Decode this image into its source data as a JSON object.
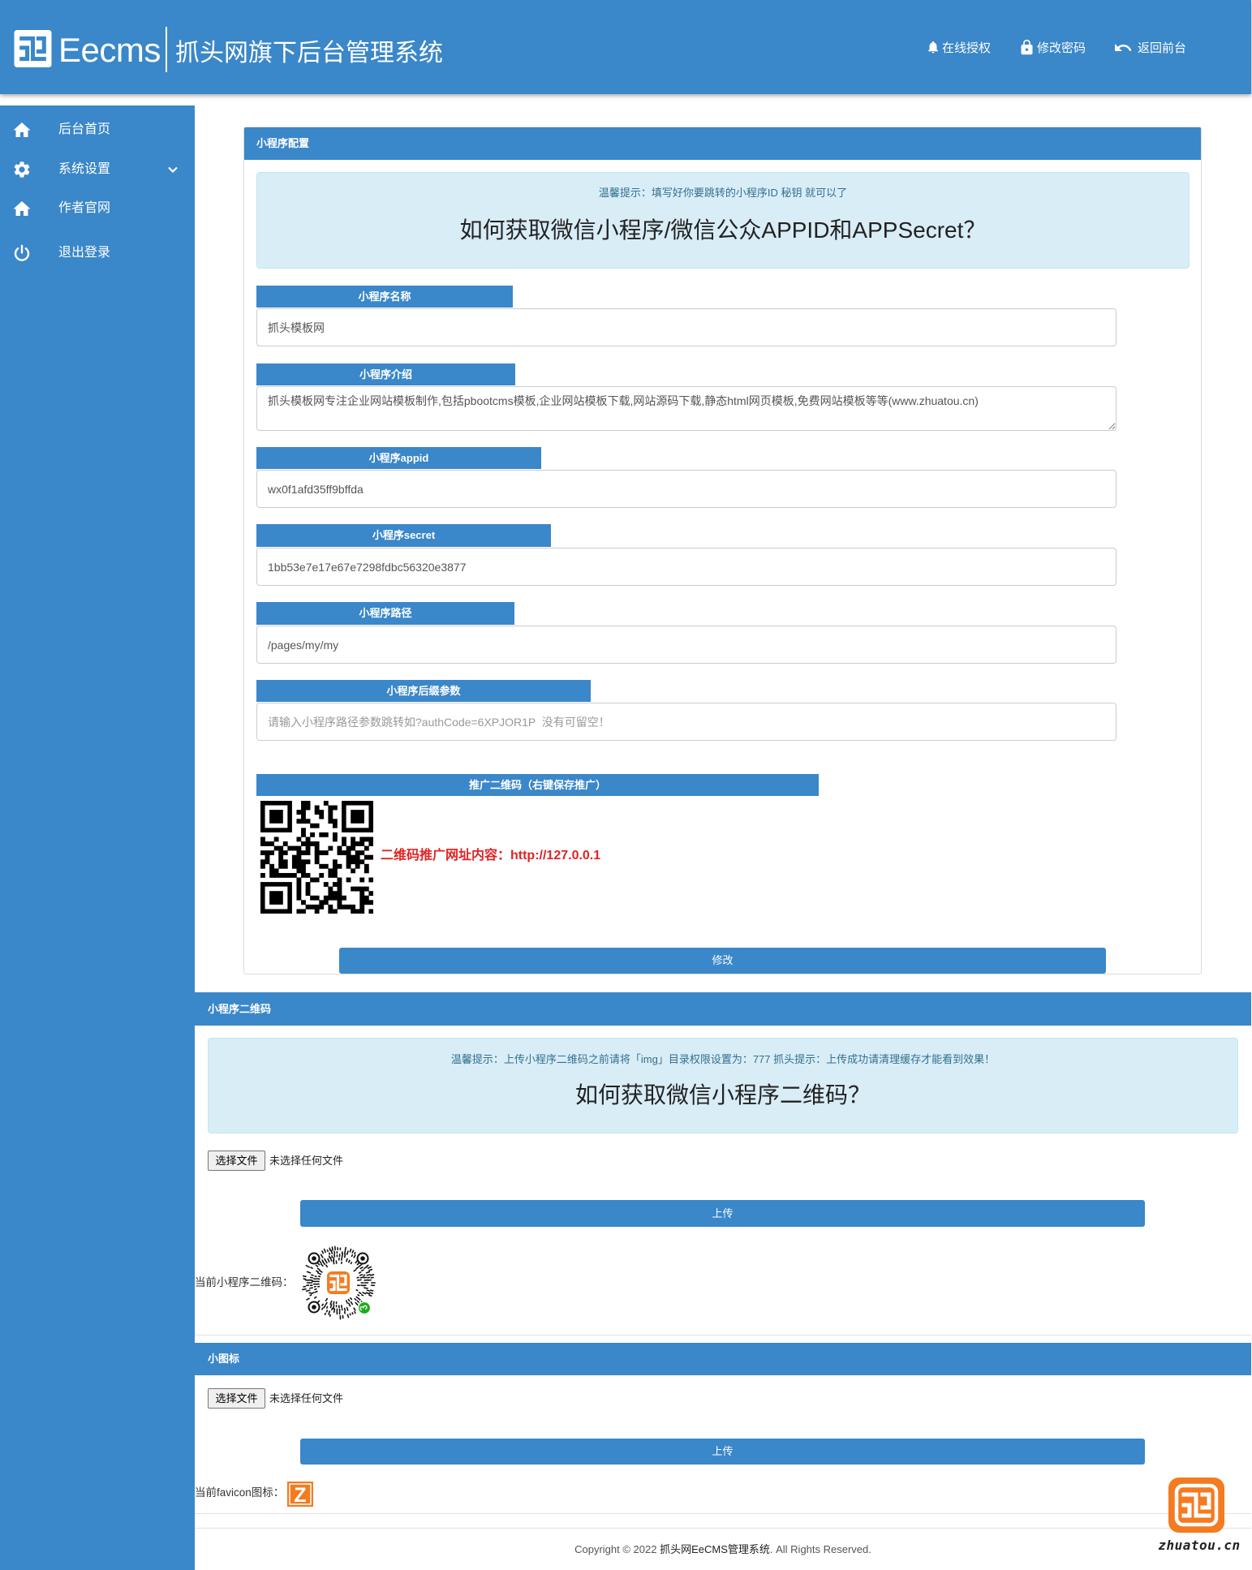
{
  "colors": {
    "primary": "#3a87c9",
    "alert_bg": "#d9edf7",
    "alert_text": "#31708f",
    "promo_text": "#e02424",
    "logo_orange": "#f47b20"
  },
  "header": {
    "brand": "Eecms",
    "subtitle": "抓头网旗下后台管理系统",
    "nav": [
      {
        "icon": "bell-icon",
        "label": "在线授权"
      },
      {
        "icon": "lock-icon",
        "label": "修改密码"
      },
      {
        "icon": "undo-icon",
        "label": "返回前台"
      }
    ]
  },
  "sidebar": {
    "items": [
      {
        "icon": "home-icon",
        "label": "后台首页"
      },
      {
        "icon": "gear-icon",
        "label": "系统设置",
        "expandable": true
      },
      {
        "icon": "home-icon",
        "label": "作者官网"
      },
      {
        "icon": "power-icon",
        "label": "退出登录"
      }
    ]
  },
  "config_panel": {
    "title": "小程序配置",
    "tip": "温馨提示：填写好你要跳转的小程序ID 秘钥 就可以了",
    "heading": "如何获取微信小程序/微信公众APPID和APPSecret？",
    "fields": {
      "name": {
        "label": "小程序名称",
        "value": "抓头模板网"
      },
      "intro": {
        "label": "小程序介绍",
        "value": "抓头模板网专注企业网站模板制作,包括pbootcms模板,企业网站模板下载,网站源码下载,静态html网页模板,免费网站模板等等(www.zhuatou.cn)"
      },
      "appid": {
        "label": "小程序appid",
        "value": "wx0f1afd35ff9bffda"
      },
      "secret": {
        "label": "小程序secret",
        "value": "1bb53e7e17e67e7298fdbc56320e3877"
      },
      "path": {
        "label": "小程序路径",
        "value": "/pages/my/my"
      },
      "suffix": {
        "label": "小程序后缀参数",
        "value": "",
        "placeholder": "请输入小程序路径参数跳转如?authCode=6XPJOR1P  没有可留空！"
      }
    },
    "promo": {
      "label": "推广二维码（右键保存推广）",
      "url_text": "二维码推广网址内容：http://127.0.0.1"
    },
    "submit": "修改"
  },
  "qrcode_panel": {
    "title": "小程序二维码",
    "tip": "温馨提示：上传小程序二维码之前请将「img」目录权限设置为：777 抓头提示：上传成功请清理缓存才能看到效果！",
    "heading": "如何获取微信小程序二维码？",
    "file_button": "选择文件",
    "file_status": "未选择任何文件",
    "upload": "上传",
    "current_label": "当前小程序二维码："
  },
  "icon_panel": {
    "title": "小图标",
    "file_button": "选择文件",
    "file_status": "未选择任何文件",
    "upload": "上传",
    "current_label": "当前favicon图标：",
    "favicon_glyph": "Z"
  },
  "footer": {
    "prefix": "Copyright © 2022 ",
    "link": "抓头网EeCMS管理系统",
    "suffix": ". All Rights Reserved."
  },
  "watermark": {
    "text": "zhuatou.cn"
  }
}
